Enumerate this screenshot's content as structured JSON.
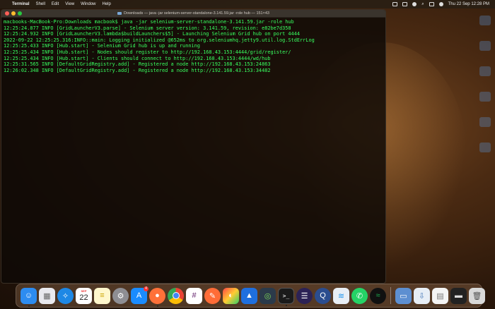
{
  "menubar": {
    "app_name": "Terminal",
    "menus": [
      "Shell",
      "Edit",
      "View",
      "Window",
      "Help"
    ],
    "datetime": "Thu 22 Sep  12:28 PM"
  },
  "terminal": {
    "title": "Downloads — java -jar selenium-server-standalone-3.141.59.jar -role hub — 151×43",
    "lines": [
      "macbooks-MacBook-Pro:Downloads macbook$ java -jar selenium-server-standalone-3.141.59.jar -role hub",
      "12:25:24.877 INFO [GridLauncherV3.parse] - Selenium server version: 3.141.59, revision: e82be7d358",
      "12:25:24.932 INFO [GridLauncherV3.lambda$buildLaunchers$5] - Launching Selenium Grid hub on port 4444",
      "2022-09-22 12:25:25.316:INFO::main: Logging initialized @652ms to org.seleniumhq.jetty9.util.log.StdErrLog",
      "12:25:25.433 INFO [Hub.start] - Selenium Grid hub is up and running",
      "12:25:25.434 INFO [Hub.start] - Nodes should register to http://192.168.43.153:4444/grid/register/",
      "12:25:25.434 INFO [Hub.start] - Clients should connect to http://192.168.43.153:4444/wd/hub",
      "12:25:31.565 INFO [DefaultGridRegistry.add] - Registered a node http://192.168.43.153:24863",
      "12:26:02.348 INFO [DefaultGridRegistry.add] - Registered a node http://192.168.43.153:34482"
    ]
  },
  "dock": {
    "calendar_month": "SEP",
    "calendar_day": "22",
    "appstore_badge": "4",
    "apps": [
      {
        "name": "finder",
        "color": "#2d8cf0"
      },
      {
        "name": "launchpad",
        "color": "#e9e9ee"
      },
      {
        "name": "safari",
        "color": "#1e88e5"
      },
      {
        "name": "calendar",
        "color": "#ffffff"
      },
      {
        "name": "notes",
        "color": "#fff7cc"
      },
      {
        "name": "system-preferences",
        "color": "#8e8e93"
      },
      {
        "name": "app-store",
        "color": "#1a8cff"
      },
      {
        "name": "firefox",
        "color": "#ff7139"
      },
      {
        "name": "chrome",
        "color": "#ffffff"
      },
      {
        "name": "slack",
        "color": "#ffffff"
      },
      {
        "name": "postman",
        "color": "#ff6c37"
      },
      {
        "name": "colorsync",
        "color": "#e0e0e0"
      },
      {
        "name": "keynote",
        "color": "#1f6fde"
      },
      {
        "name": "android-studio",
        "color": "#2b3a4a"
      },
      {
        "name": "terminal",
        "color": "#1b1b1b"
      },
      {
        "name": "eclipse",
        "color": "#2c2255"
      },
      {
        "name": "quicktime",
        "color": "#2b4d8f"
      },
      {
        "name": "docker",
        "color": "#e8eef5"
      },
      {
        "name": "whatsapp",
        "color": "#25d366"
      },
      {
        "name": "spotify",
        "color": "#111111"
      },
      {
        "name": "preview",
        "color": "#5d8fd1"
      },
      {
        "name": "downloads-stack",
        "color": "#e7eef6"
      },
      {
        "name": "documents-stack",
        "color": "#f4f4f4"
      },
      {
        "name": "trash",
        "color": "#d9d9d9"
      }
    ]
  }
}
